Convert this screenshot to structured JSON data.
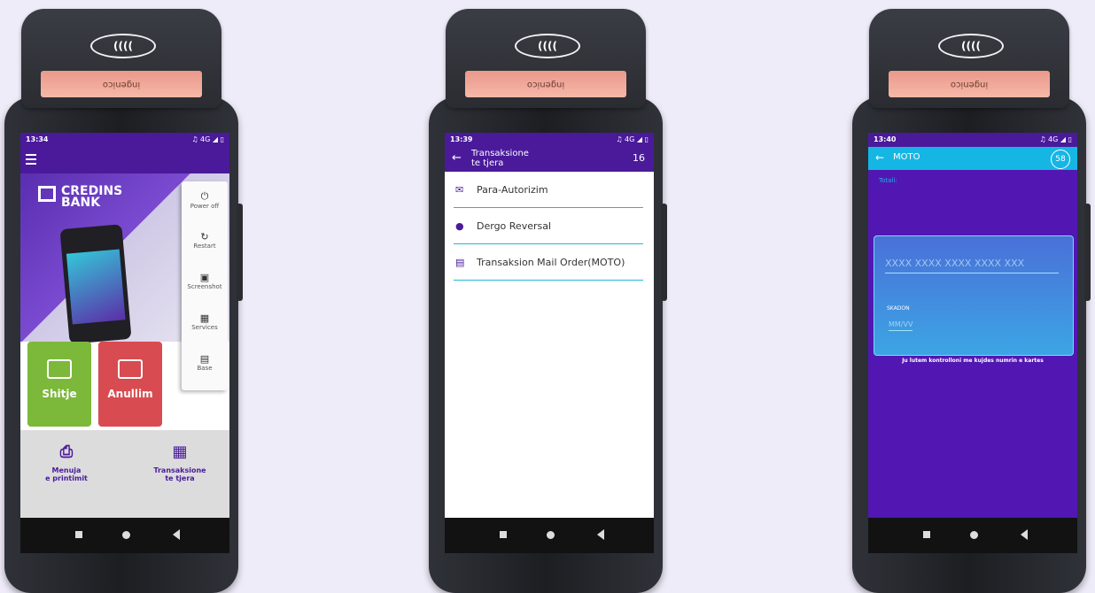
{
  "device_brand": "ingenico",
  "nfc_label": "((((",
  "screen1": {
    "status": {
      "time": "13:34",
      "icons": "⊠ ⊙",
      "right": "♫ 4G ◢ ▯"
    },
    "bank_name_line1": "CREDINS",
    "bank_name_line2": "BANK",
    "tiles": {
      "sale": "Shitje",
      "void": "Anullim"
    },
    "bottom": {
      "print_menu_line1": "Menuja",
      "print_menu_line2": "e printimit",
      "other_tx_line1": "Transaksione",
      "other_tx_line2": "te tjera"
    },
    "power_menu": [
      {
        "icon": "⏻",
        "label": "Power off"
      },
      {
        "icon": "↻",
        "label": "Restart"
      },
      {
        "icon": "▣",
        "label": "Screenshot"
      },
      {
        "icon": "▦",
        "label": "Services"
      },
      {
        "icon": "▤",
        "label": "Base"
      }
    ]
  },
  "screen2": {
    "status": {
      "time": "13:39",
      "right": "♫ 4G ◢ ▯"
    },
    "title_line1": "Transaksione",
    "title_line2": "te tjera",
    "timer": "16",
    "items": [
      {
        "icon": "✉",
        "label": "Para-Autorizim"
      },
      {
        "icon": "●",
        "label": "Dergo Reversal"
      },
      {
        "icon": "▤",
        "label": "Transaksion Mail Order(MOTO)"
      }
    ]
  },
  "screen3": {
    "status": {
      "time": "13:40",
      "right": "♫ 4G ◢ ▯"
    },
    "title": "MOTO",
    "timer": "58",
    "totali_label": "Totali:",
    "card_number_placeholder": "XXXX XXXX XXXX XXXX XXX",
    "expiry_label": "SKADON",
    "expiry_placeholder": "MM/VV",
    "note": "Ju lutem kontrolloni me kujdes numrin e kartes"
  }
}
